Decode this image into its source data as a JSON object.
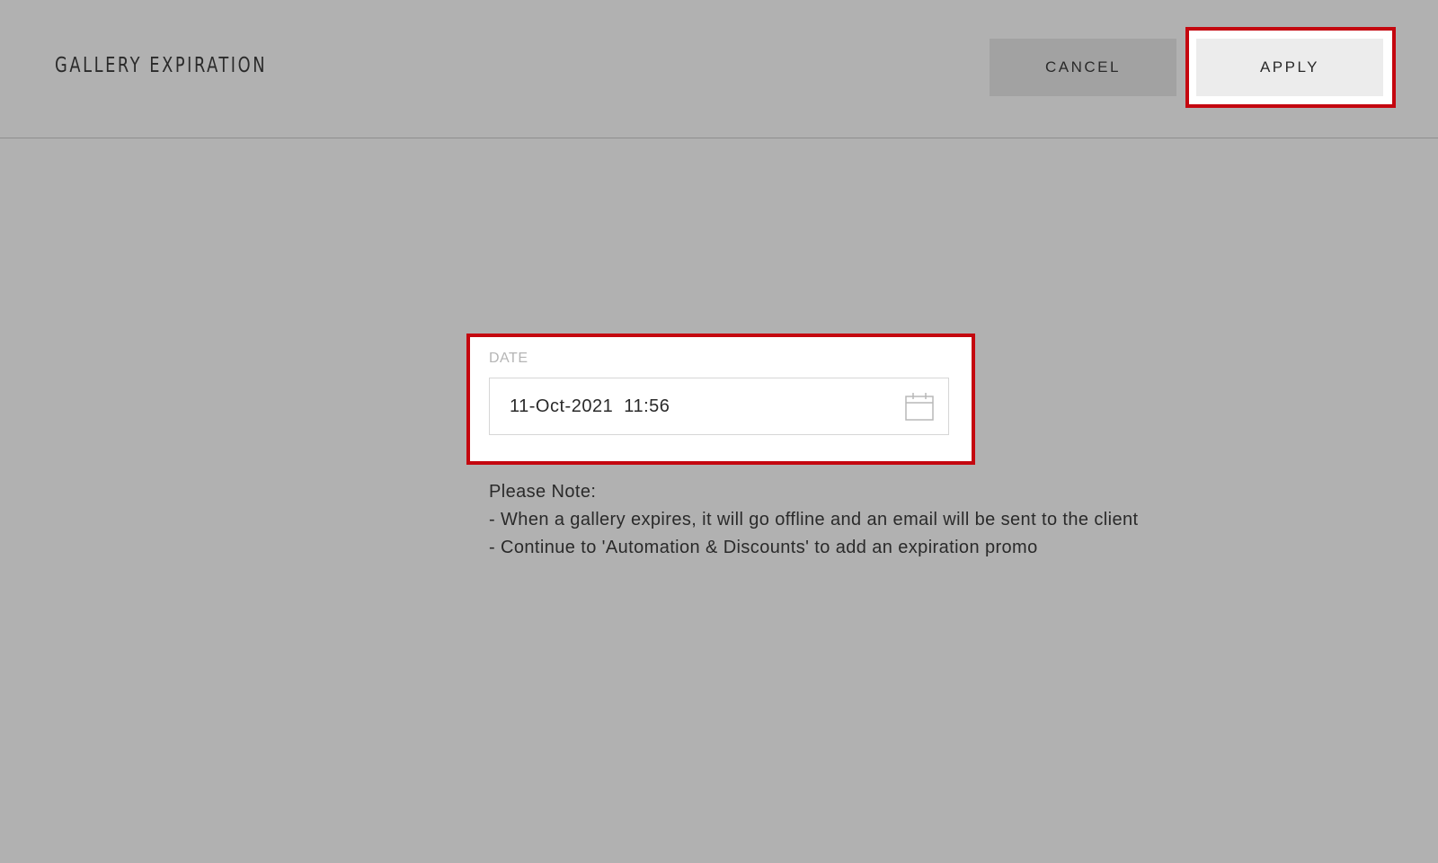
{
  "header": {
    "title": "GALLERY EXPIRATION",
    "cancel_label": "CANCEL",
    "apply_label": "APPLY"
  },
  "date_field": {
    "label": "DATE",
    "value": "11-Oct-2021  11:56",
    "icon": "calendar-icon"
  },
  "note": {
    "heading": "Please Note:",
    "lines": [
      "- When a gallery expires, it will go offline and an email will be sent to the client",
      "- Continue to 'Automation & Discounts' to add an expiration promo"
    ]
  },
  "colors": {
    "background": "#b1b1b1",
    "highlight": "#c4070f",
    "cancel_button": "#a2a2a2",
    "apply_button": "#ececec"
  }
}
